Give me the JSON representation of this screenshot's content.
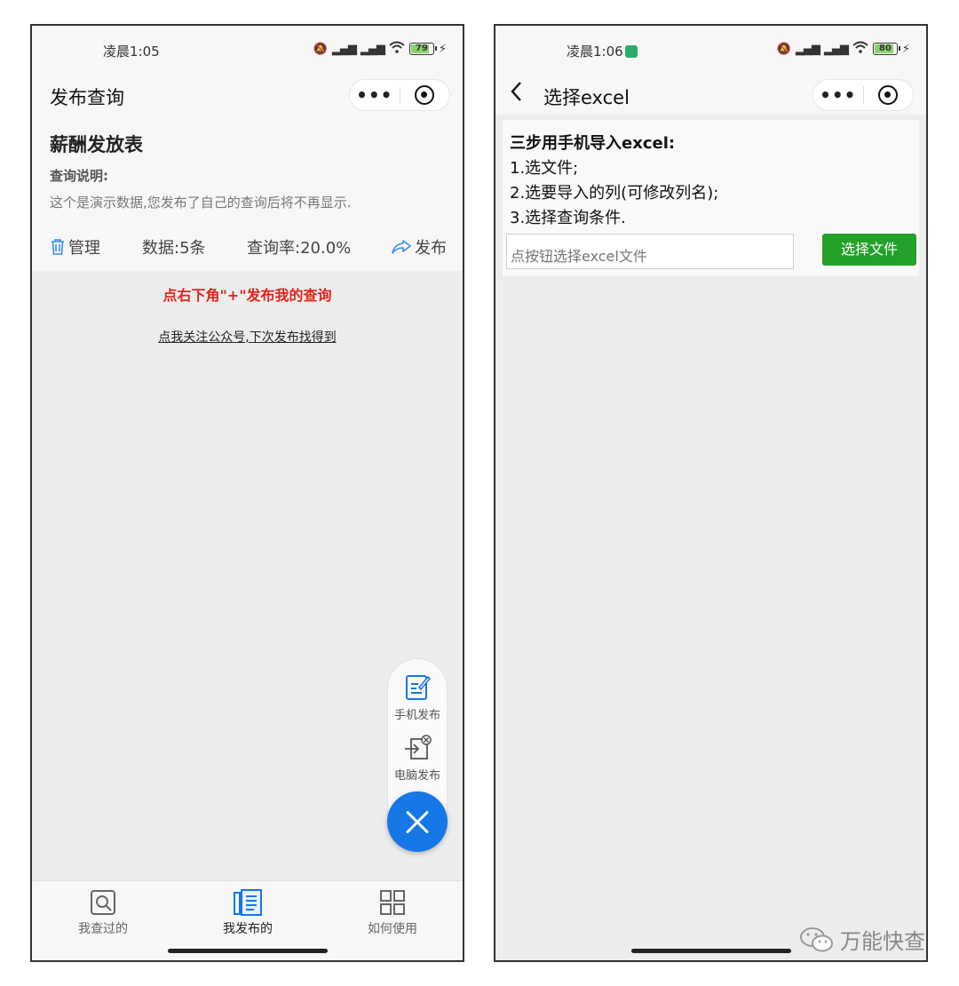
{
  "left": {
    "status_time": "凌晨1:05",
    "battery": "79",
    "nav_title": "发布查询",
    "card": {
      "title": "薪酬发放表",
      "subtitle": "查询说明:",
      "description": "这个是演示数据,您发布了自己的查询后将不再显示.",
      "manage_label": "管理",
      "count_label": "数据:5条",
      "rate_label": "查询率:20.0%",
      "publish_label": "发布"
    },
    "red_hint": "点右下角\"+\"发布我的查询",
    "follow_link": "点我关注公众号,下次发布找得到",
    "fab": {
      "mobile_publish": "手机发布",
      "pc_publish": "电脑发布"
    },
    "tabs": [
      {
        "label": "我查过的",
        "icon": "search-doc-icon"
      },
      {
        "label": "我发布的",
        "icon": "published-doc-icon"
      },
      {
        "label": "如何使用",
        "icon": "grid-icon"
      }
    ],
    "colors": {
      "accent_blue": "#1677e6",
      "hint_red": "#e2231a"
    }
  },
  "right": {
    "status_time": "凌晨1:06",
    "battery": "80",
    "nav_title": "选择excel",
    "instructions": {
      "title": "三步用手机导入excel:",
      "steps": [
        "1.选文件;",
        "2.选要导入的列(可修改列名);",
        "3.选择查询条件."
      ]
    },
    "file_input_placeholder": "点按钮选择excel文件",
    "choose_button": "选择文件",
    "colors": {
      "button_green": "#23a129"
    }
  },
  "watermark": "万能快查"
}
